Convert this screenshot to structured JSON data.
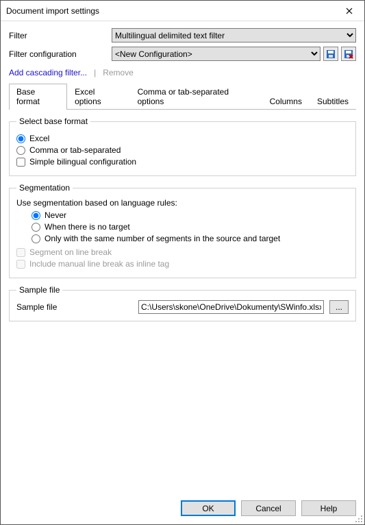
{
  "window": {
    "title": "Document import settings"
  },
  "filter": {
    "label": "Filter",
    "value": "Multilingual delimited text filter"
  },
  "filterConfig": {
    "label": "Filter configuration",
    "value": "<New Configuration>"
  },
  "links": {
    "add": "Add cascading filter...",
    "separator": "|",
    "remove": "Remove"
  },
  "tabs": {
    "items": [
      {
        "label": "Base format",
        "active": true
      },
      {
        "label": "Excel options",
        "active": false
      },
      {
        "label": "Comma or tab-separated options",
        "active": false
      },
      {
        "label": "Columns",
        "active": false
      },
      {
        "label": "Subtitles",
        "active": false
      }
    ]
  },
  "baseFormat": {
    "legend": "Select base format",
    "excel": "Excel",
    "comma": "Comma or tab-separated",
    "simpleBilingual": "Simple bilingual configuration"
  },
  "segmentation": {
    "legend": "Segmentation",
    "intro": "Use segmentation based on language rules:",
    "never": "Never",
    "noTarget": "When there is no target",
    "sameSegments": "Only with the same number of segments in the source and target",
    "segLineBreak": "Segment on line break",
    "inlineTag": "Include manual line break as inline tag"
  },
  "sample": {
    "legend": "Sample file",
    "label": "Sample file",
    "path": "C:\\Users\\skone\\OneDrive\\Dokumenty\\SWinfo.xlsx",
    "browse": "..."
  },
  "buttons": {
    "ok": "OK",
    "cancel": "Cancel",
    "help": "Help"
  }
}
